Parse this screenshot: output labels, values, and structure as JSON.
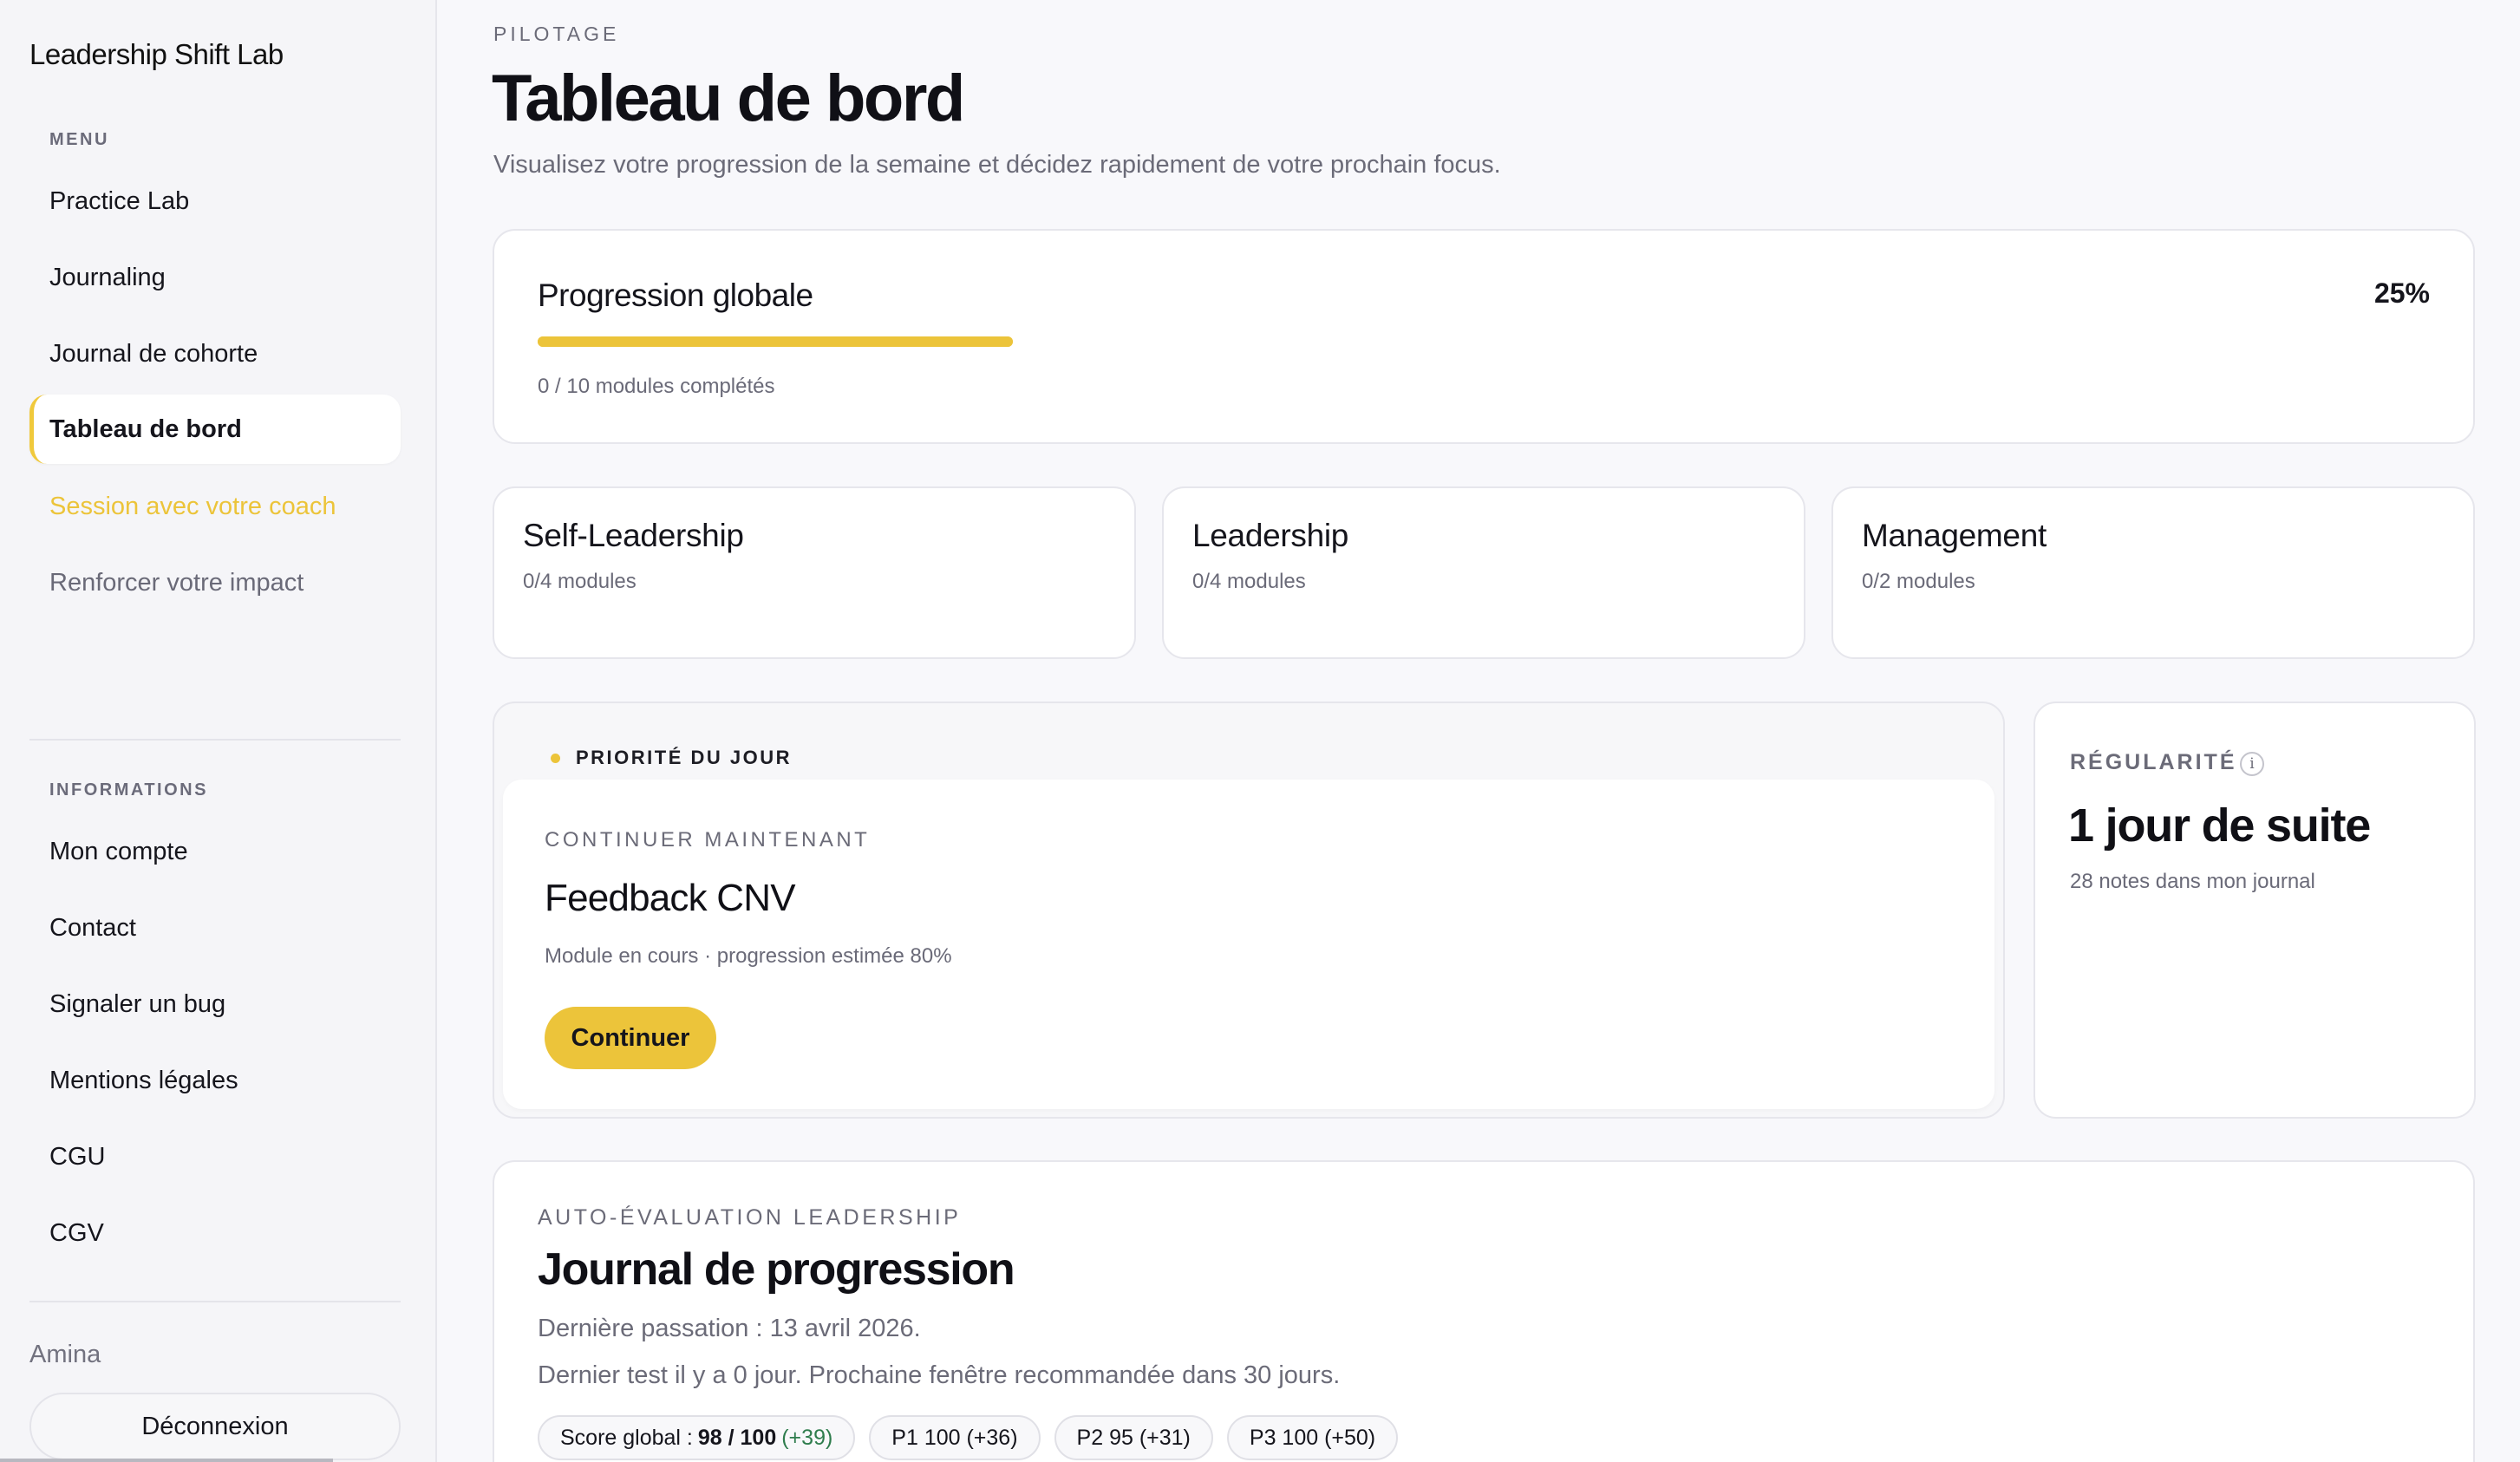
{
  "sidebar": {
    "brand": "Leadership Shift Lab",
    "menu_label": "MENU",
    "menu_items": [
      {
        "label": "Practice Lab"
      },
      {
        "label": "Journaling"
      },
      {
        "label": "Journal de cohorte"
      },
      {
        "label": "Tableau de bord",
        "active": true
      },
      {
        "label": "Session avec votre coach"
      },
      {
        "label": "Renforcer votre impact"
      }
    ],
    "info_label": "INFORMATIONS",
    "info_items": [
      {
        "label": "Mon compte"
      },
      {
        "label": "Contact"
      },
      {
        "label": "Signaler un bug"
      },
      {
        "label": "Mentions légales"
      },
      {
        "label": "CGU"
      },
      {
        "label": "CGV"
      }
    ],
    "user_name": "Amina",
    "logout_label": "Déconnexion"
  },
  "header": {
    "eyebrow": "PILOTAGE",
    "title": "Tableau de bord",
    "subtitle": "Visualisez votre progression de la semaine et décidez rapidement de votre prochain focus."
  },
  "progress": {
    "title": "Progression globale",
    "percent_label": "25%",
    "percent_value": 0.25,
    "modules_text": "0 / 10 modules complétés"
  },
  "categories": [
    {
      "title": "Self-Leadership",
      "modules": "0/4 modules"
    },
    {
      "title": "Leadership",
      "modules": "0/4 modules"
    },
    {
      "title": "Management",
      "modules": "0/2 modules"
    }
  ],
  "priority": {
    "label": "PRIORITÉ DU JOUR",
    "eyebrow": "CONTINUER MAINTENANT",
    "title": "Feedback CNV",
    "subtitle": "Module en cours · progression estimée 80%",
    "button_label": "Continuer"
  },
  "regularity": {
    "label": "RÉGULARITÉ",
    "info_icon_glyph": "i",
    "value": "1 jour de suite",
    "subtitle": "28 notes dans mon journal"
  },
  "evaluation": {
    "eyebrow": "AUTO-ÉVALUATION LEADERSHIP",
    "title": "Journal de progression",
    "last_test": "Dernière passation : 13 avril 2026.",
    "next_window": "Dernier test il y a 0 jour. Prochaine fenêtre recommandée dans 30 jours.",
    "score_prefix": "Score global :",
    "score_value": "98 / 100",
    "score_delta": "(+39)",
    "pills": [
      "P1 100 (+36)",
      "P2 95 (+31)",
      "P3 100 (+50)"
    ]
  },
  "colors": {
    "accent": "#ecc43a",
    "positive_delta": "#2f7d4d"
  }
}
